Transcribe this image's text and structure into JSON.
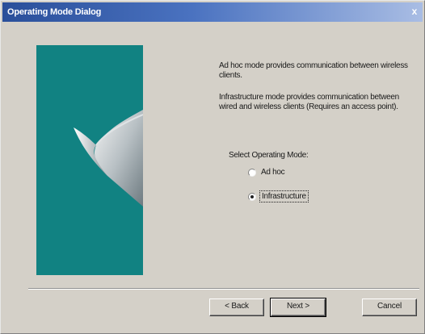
{
  "window": {
    "title": "Operating Mode Dialog",
    "close_glyph": "x"
  },
  "description": {
    "adhoc": "Ad hoc mode provides communication between wireless clients.",
    "infrastructure": "Infrastructure mode provides communication between wired and wireless clients (Requires an access point)."
  },
  "mode_selection": {
    "label": "Select Operating Mode:",
    "options": [
      {
        "label": "Ad hoc",
        "selected": false
      },
      {
        "label": "Infrastructure",
        "selected": true
      }
    ]
  },
  "buttons": {
    "back": "< Back",
    "next": "Next >",
    "cancel": "Cancel"
  },
  "colors": {
    "side_panel": "#118282",
    "titlebar_start": "#2a4f9a",
    "dialog_bg": "#d4d0c8"
  }
}
